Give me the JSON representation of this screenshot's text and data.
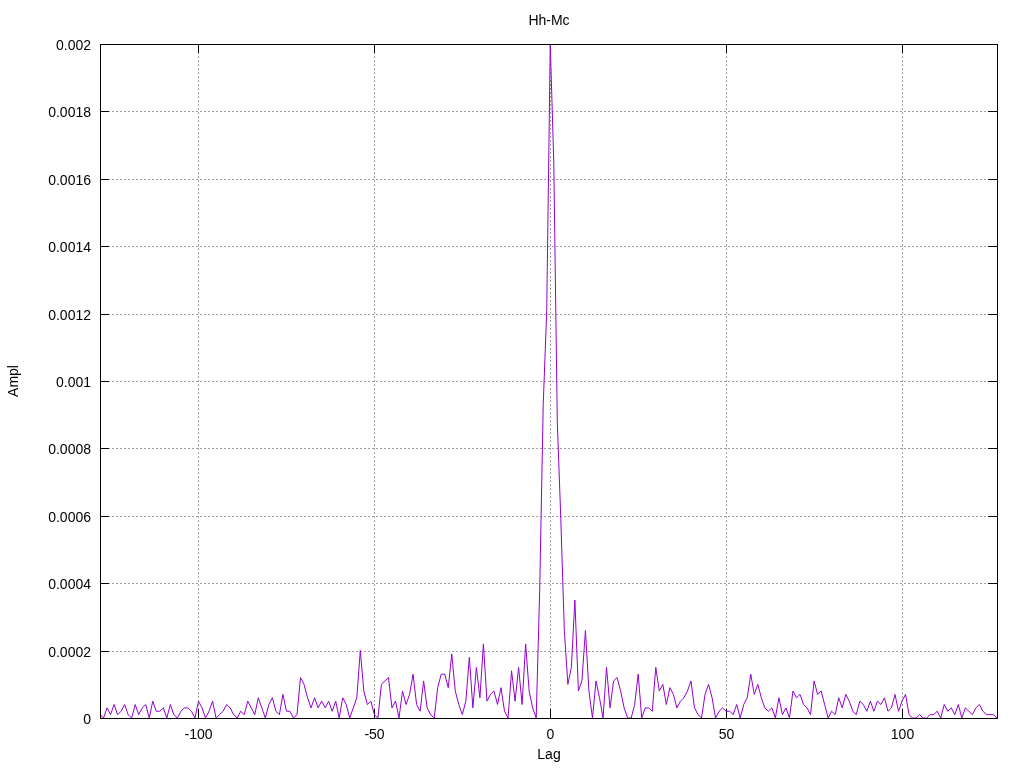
{
  "chart_data": {
    "type": "line",
    "title": "Hh-Mc",
    "xlabel": "Lag",
    "ylabel": "Ampl",
    "xlim": [
      -128,
      127
    ],
    "ylim": [
      0,
      0.002
    ],
    "grid": true,
    "xticks": [
      -100,
      -50,
      0,
      50,
      100
    ],
    "yticks": [
      0,
      0.0002,
      0.0004,
      0.0006,
      0.0008,
      0.001,
      0.0012,
      0.0014,
      0.0016,
      0.0018,
      0.002
    ],
    "x": [
      -128,
      -127,
      -126,
      -125,
      -124,
      -123,
      -122,
      -121,
      -120,
      -119,
      -118,
      -117,
      -116,
      -115,
      -114,
      -113,
      -112,
      -111,
      -110,
      -109,
      -108,
      -107,
      -106,
      -105,
      -104,
      -103,
      -102,
      -101,
      -100,
      -99,
      -98,
      -97,
      -96,
      -95,
      -94,
      -93,
      -92,
      -91,
      -90,
      -89,
      -88,
      -87,
      -86,
      -85,
      -84,
      -83,
      -82,
      -81,
      -80,
      -79,
      -78,
      -77,
      -76,
      -75,
      -74,
      -73,
      -72,
      -71,
      -70,
      -69,
      -68,
      -67,
      -66,
      -65,
      -64,
      -63,
      -62,
      -61,
      -60,
      -59,
      -58,
      -57,
      -56,
      -55,
      -54,
      -53,
      -52,
      -51,
      -50,
      -49,
      -48,
      -47,
      -46,
      -45,
      -44,
      -43,
      -42,
      -41,
      -40,
      -39,
      -38,
      -37,
      -36,
      -35,
      -34,
      -33,
      -32,
      -31,
      -30,
      -29,
      -28,
      -27,
      -26,
      -25,
      -24,
      -23,
      -22,
      -21,
      -20,
      -19,
      -18,
      -17,
      -16,
      -15,
      -14,
      -13,
      -12,
      -11,
      -10,
      -9,
      -8,
      -7,
      -6,
      -5,
      -4,
      -3,
      -2,
      -1,
      0,
      1,
      2,
      3,
      4,
      5,
      6,
      7,
      8,
      9,
      10,
      11,
      12,
      13,
      14,
      15,
      16,
      17,
      18,
      19,
      20,
      21,
      22,
      23,
      24,
      25,
      26,
      27,
      28,
      29,
      30,
      31,
      32,
      33,
      34,
      35,
      36,
      37,
      38,
      39,
      40,
      41,
      42,
      43,
      44,
      45,
      46,
      47,
      48,
      49,
      50,
      51,
      52,
      53,
      54,
      55,
      56,
      57,
      58,
      59,
      60,
      61,
      62,
      63,
      64,
      65,
      66,
      67,
      68,
      69,
      70,
      71,
      72,
      73,
      74,
      75,
      76,
      77,
      78,
      79,
      80,
      81,
      82,
      83,
      84,
      85,
      86,
      87,
      88,
      89,
      90,
      91,
      92,
      93,
      94,
      95,
      96,
      97,
      98,
      99,
      100,
      101,
      102,
      103,
      104,
      105,
      106,
      107,
      108,
      109,
      110,
      111,
      112,
      113,
      114,
      115,
      116,
      117,
      118,
      119,
      120,
      121,
      122,
      123,
      124,
      125,
      126,
      127
    ],
    "series": [
      {
        "color": "#9400d3",
        "values": [
          1e-05,
          0,
          3e-05,
          1e-05,
          4e-05,
          1e-05,
          2e-05,
          4e-05,
          1e-05,
          0,
          4e-05,
          1e-05,
          3e-05,
          4e-05,
          0,
          5e-05,
          2e-05,
          2e-05,
          3e-05,
          0,
          4e-05,
          1e-05,
          0,
          2e-05,
          3e-05,
          3e-05,
          2e-05,
          0,
          5e-05,
          3e-05,
          0,
          2e-05,
          5e-05,
          0,
          1e-05,
          2e-05,
          4e-05,
          3e-05,
          1e-05,
          0,
          2e-05,
          1e-05,
          5e-05,
          3e-05,
          1e-05,
          6e-05,
          3e-05,
          0,
          4e-05,
          6e-05,
          2e-05,
          1e-05,
          7e-05,
          2e-05,
          2e-05,
          0,
          1e-05,
          0.00012,
          0.0001,
          6e-05,
          3e-05,
          6e-05,
          3e-05,
          5e-05,
          3e-05,
          5e-05,
          2e-05,
          5e-05,
          0,
          6e-05,
          4e-05,
          0,
          3e-05,
          6e-05,
          0.0002,
          8e-05,
          4e-05,
          5e-05,
          1e-05,
          0,
          0.0001,
          0.00011,
          0.00012,
          3e-05,
          5e-05,
          0,
          8e-05,
          4e-05,
          7e-05,
          0.00013,
          4e-05,
          2e-05,
          0.00011,
          3e-05,
          1e-05,
          0,
          9e-05,
          0.00013,
          0.00013,
          9e-05,
          0.00019,
          8e-05,
          4e-05,
          1e-05,
          5e-05,
          0.00018,
          3e-05,
          0.00015,
          6e-05,
          0.00022,
          5e-05,
          7e-05,
          8e-05,
          4e-05,
          9e-05,
          2e-05,
          0,
          0.00014,
          5e-05,
          0.00015,
          4e-05,
          0.00022,
          8e-05,
          3e-05,
          0,
          0.00038,
          0.00093,
          0.00121,
          0.002,
          0.00165,
          0.00088,
          0.00059,
          0.00026,
          0.0001,
          0.00015,
          0.00035,
          8e-05,
          0.00011,
          0.00026,
          8e-05,
          0,
          0.00011,
          6e-05,
          0,
          0.00015,
          3e-05,
          0.00011,
          0.00012,
          8e-05,
          3e-05,
          0,
          0,
          4e-05,
          0.00013,
          0,
          3e-05,
          3e-05,
          2e-05,
          0.00015,
          8e-05,
          0.0001,
          4e-05,
          9e-05,
          7e-05,
          3e-05,
          5e-05,
          6e-05,
          8e-05,
          0.00011,
          3e-05,
          1e-05,
          0,
          7e-05,
          0.0001,
          6e-05,
          0,
          2e-05,
          3e-05,
          2e-05,
          2e-05,
          1e-05,
          4e-05,
          0,
          4e-05,
          6e-05,
          0.00013,
          7e-05,
          0.0001,
          6e-05,
          3e-05,
          2e-05,
          3e-05,
          0,
          6e-05,
          1e-05,
          3e-05,
          0,
          8e-05,
          6e-05,
          7e-05,
          4e-05,
          3e-05,
          1e-05,
          0.00011,
          7e-05,
          8e-05,
          4e-05,
          0,
          2e-05,
          1e-05,
          6e-05,
          3e-05,
          7e-05,
          5e-05,
          2e-05,
          1e-05,
          5e-05,
          4e-05,
          2e-05,
          5e-05,
          2e-05,
          5e-05,
          4e-05,
          6e-05,
          2e-05,
          3e-05,
          7e-05,
          2e-05,
          5e-05,
          7e-05,
          1e-05,
          0,
          0,
          1e-05,
          0,
          0,
          1e-05,
          1e-05,
          2e-05,
          0,
          4e-05,
          2e-05,
          3e-05,
          1e-05,
          4e-05,
          0,
          3e-05,
          2e-05,
          1e-05,
          3e-05,
          4e-05,
          2e-05,
          1e-05,
          1e-05,
          1e-05,
          0
        ]
      }
    ]
  }
}
